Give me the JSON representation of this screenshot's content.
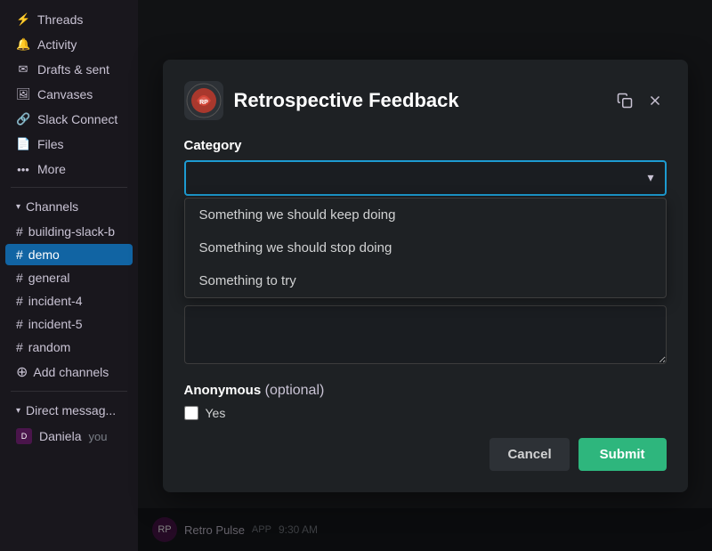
{
  "sidebar": {
    "nav_items": [
      {
        "id": "threads",
        "label": "Threads",
        "icon": "⚡"
      },
      {
        "id": "activity",
        "label": "Activity",
        "icon": "🔔"
      },
      {
        "id": "drafts",
        "label": "Drafts & sent",
        "icon": "✉"
      },
      {
        "id": "canvases",
        "label": "Canvases",
        "icon": "🖼"
      },
      {
        "id": "slack-connect",
        "label": "Slack Connect",
        "icon": "🔗"
      },
      {
        "id": "files",
        "label": "Files",
        "icon": "📄"
      },
      {
        "id": "more",
        "label": "More",
        "icon": "⋯"
      }
    ],
    "channels_header": "Channels",
    "channels": [
      {
        "id": "building-slack-b",
        "name": "building-slack-b",
        "active": false
      },
      {
        "id": "demo",
        "name": "demo",
        "active": true
      },
      {
        "id": "general",
        "name": "general",
        "active": false
      },
      {
        "id": "incident-4",
        "name": "incident-4",
        "active": false
      },
      {
        "id": "incident-5",
        "name": "incident-5",
        "active": false
      },
      {
        "id": "random",
        "name": "random",
        "active": false
      }
    ],
    "add_channels_label": "Add channels",
    "dm_header": "Direct messag...",
    "dm_items": [
      {
        "id": "daniela",
        "name": "Daniela",
        "sub": "you"
      }
    ]
  },
  "modal": {
    "title": "Retrospective Feedback",
    "logo_alt": "Retro Pulse",
    "category_label": "Category",
    "select_placeholder": "",
    "dropdown_options": [
      "Something we should keep doing",
      "Something we should stop doing",
      "Something to try"
    ],
    "anonymous_label": "Anonymous",
    "anonymous_optional": "(optional)",
    "checkbox_label": "Yes",
    "cancel_btn": "Cancel",
    "submit_btn": "Submit"
  },
  "status_bar": {
    "app_name": "Retro Pulse",
    "app_type": "APP",
    "time": "9:30 AM"
  }
}
